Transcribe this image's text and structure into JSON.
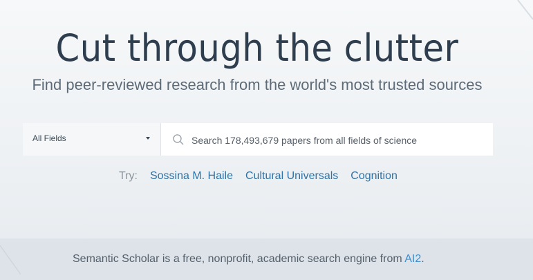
{
  "hero": {
    "title": "Cut through the clutter",
    "subtitle": "Find peer-reviewed research from the world's most trusted sources"
  },
  "search": {
    "field_selected": "All Fields",
    "placeholder": "Search 178,493,679 papers from all fields of science",
    "icon": "search-icon"
  },
  "try": {
    "label": "Try:",
    "suggestions": [
      "Sossina M. Haile",
      "Cultural Universals",
      "Cognition"
    ]
  },
  "footer": {
    "text_before": "Semantic Scholar is a free, nonprofit, academic search engine from ",
    "link": "AI2",
    "text_after": "."
  },
  "colors": {
    "title": "#2e3e4e",
    "link": "#2f72a3",
    "footer_link": "#3b8fd0"
  }
}
